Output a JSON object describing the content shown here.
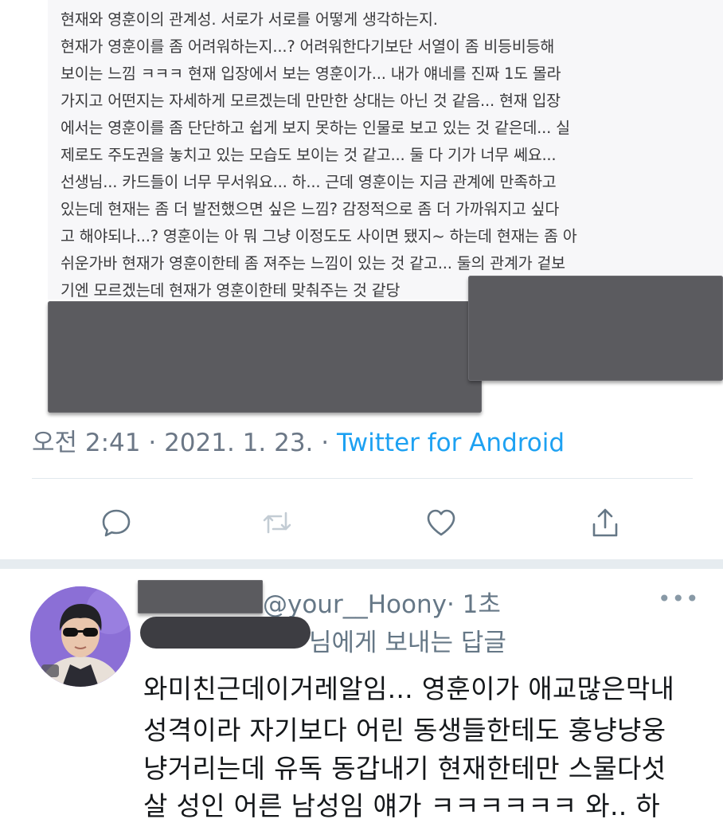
{
  "tweet": {
    "image_lines": [
      "현재와 영훈이의 관계성. 서로가 서로를 어떻게 생각하는지.",
      "현재가 영훈이를 좀 어려워하는지...? 어려워한다기보단 서열이 좀 비등비등해",
      "보이는 느낌 ㅋㅋㅋ 현재 입장에서 보는 영훈이가... 내가 얘네를 진짜 1도 몰라",
      "가지고 어떤지는 자세하게 모르겠는데 만만한 상대는 아닌 것 같음... 현재 입장",
      "에서는 영훈이를 좀 단단하고 쉽게 보지 못하는 인물로 보고 있는 것 같은데... 실",
      "제로도 주도권을 놓치고 있는 모습도 보이는 것 같고... 둘 다 기가 너무 쎄요...",
      "선생님... 카드들이 너무 무서워요... 하... 근데 영훈이는 지금 관계에 만족하고",
      "있는데 현재는 좀 더 발전했으면 싶은 느낌? 감정적으로 좀 더 가까워지고 싶다",
      "고 해야되나...? 영훈이는 아 뭐 그냥 이정도도 사이면 됐지~ 하는데 현재는 좀 아",
      "쉬운가바 현재가 영훈이한테 좀 져주는 느낌이 있는 것 같고... 둘의 관계가 겉보",
      "기엔 모르겠는데 현재가 영훈이한테 맞춰주는 것 같당"
    ],
    "time": "오전 2:41",
    "separator": " · ",
    "date": "2021. 1. 23.",
    "source": "Twitter for Android"
  },
  "actions": {
    "reply_icon": "speech-bubble-icon",
    "retweet_icon": "retweet-icon",
    "like_icon": "heart-icon",
    "share_icon": "share-icon"
  },
  "reply": {
    "handle": "@your__Hoony",
    "age": "· 1초",
    "replying_to_suffix": "님에게 보내는 답글",
    "more": "•••",
    "text_lines": [
      "와미친근데이거레알임... 영훈이가 애교많은막내",
      "성격이라 자기보다 어린 동생들한테도 훙냥냥웅",
      "냥거리는데 유독 동갑내기 현재한테만 스물다섯",
      "살 성인 어른 남성임 얘가 ㅋㅋㅋㅋㅋㅋ 와.. 하"
    ]
  },
  "colors": {
    "link": "#1da1f2",
    "meta_gray": "#6b7786",
    "icon_gray": "#657786",
    "redaction": "#5b5b5f"
  }
}
